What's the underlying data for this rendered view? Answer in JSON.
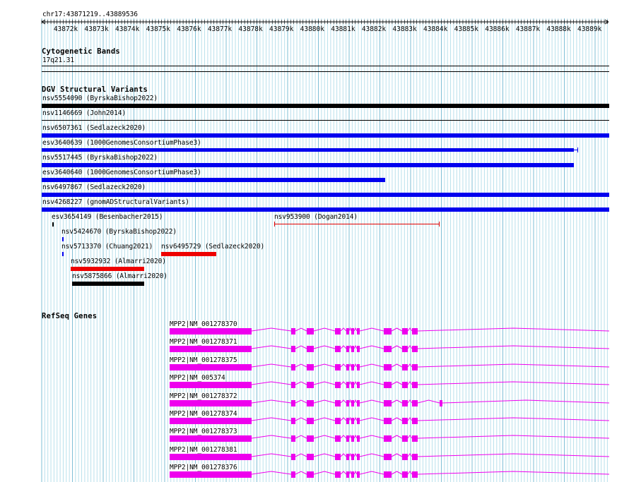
{
  "coords": "chr17:43871219..43889536",
  "ruler_ticks": [
    "43872k",
    "43873k",
    "43874k",
    "43875k",
    "43876k",
    "43877k",
    "43878k",
    "43879k",
    "43880k",
    "43881k",
    "43882k",
    "43883k",
    "43884k",
    "43885k",
    "43886k",
    "43887k",
    "43888k",
    "43889k"
  ],
  "tracks": {
    "cyto": {
      "title": "Cytogenetic Bands",
      "band": "17q21.31"
    },
    "dgv": {
      "title": "DGV Structural Variants",
      "items": [
        {
          "label": "nsv5554090 (ByrskaBishop2022)",
          "color": "#000000"
        },
        {
          "label": "nsv1146669 (John2014)",
          "color": "#000000"
        },
        {
          "label": "nsv6507361 (Sedlazeck2020)",
          "color": "#0000ee"
        },
        {
          "label": "esv3640639 (1000GenomesConsortiumPhase3)",
          "color": "#0000ee"
        },
        {
          "label": "nsv5517445 (ByrskaBishop2022)",
          "color": "#0000ee"
        },
        {
          "label": "esv3640640 (1000GenomesConsortiumPhase3)",
          "color": "#0000ee"
        },
        {
          "label": "nsv6497867 (Sedlazeck2020)",
          "color": "#0000ee"
        },
        {
          "label": "nsv4268227 (gnomADStructuralVariants)",
          "color": "#0000ee"
        },
        {
          "label": "esv3654149 (Besenbacher2015)",
          "color": "#000000"
        },
        {
          "label": "nsv953900 (Dogan2014)",
          "color": "#e00000"
        },
        {
          "label": "nsv5424670 (ByrskaBishop2022)",
          "color": "#0000ee"
        },
        {
          "label": "nsv5713370 (Chuang2021)",
          "color": "#0000ee"
        },
        {
          "label": "nsv6495729 (Sedlazeck2020)",
          "color": "#ee0000"
        },
        {
          "label": "nsv5932932 (Almarri2020)",
          "color": "#ee0000"
        },
        {
          "label": "nsv5875866 (Almarri2020)",
          "color": "#000000"
        }
      ]
    },
    "refseq": {
      "title": "RefSeq Genes",
      "color": "#ee00ee",
      "items": [
        "MPP2|NM_001278370",
        "MPP2|NM_001278371",
        "MPP2|NM_001278375",
        "MPP2|NM_005374",
        "MPP2|NM_001278372",
        "MPP2|NM_001278374",
        "MPP2|NM_001278373",
        "MPP2|NM_001278381",
        "MPP2|NM_001278376"
      ]
    }
  }
}
